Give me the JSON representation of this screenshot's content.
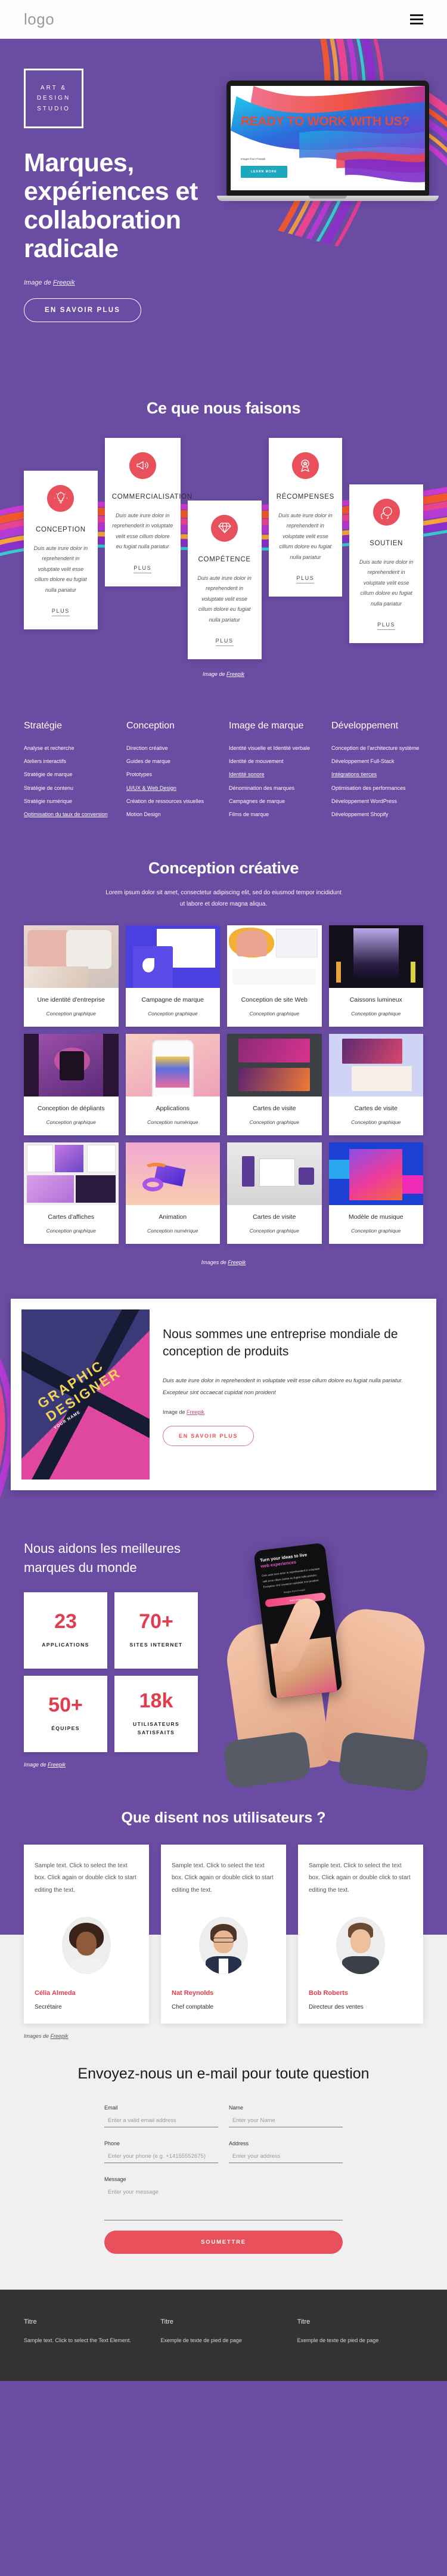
{
  "navbar": {
    "logo": "logo",
    "menu_icon": "hamburger-icon"
  },
  "hero": {
    "badge_lines": [
      "ART &",
      "DESIGN",
      "STUDIO"
    ],
    "title": "Marques, expériences et collaboration radicale",
    "credit_prefix": "Image de ",
    "credit_link": "Freepik",
    "cta": "EN SAVOIR PLUS",
    "laptop": {
      "headline": "READY TO WORK WITH US?",
      "credit": "Images from Freepik",
      "button": "LEARN MORE"
    }
  },
  "services": {
    "title": "Ce que nous faisons",
    "more_label": "PLUS",
    "credit_prefix": "Image de ",
    "credit_link": "Freepik",
    "body": "Duis aute irure dolor in reprehenderit in voluptate velit esse cillum dolore eu fugiat nulla pariatur",
    "items": [
      {
        "name": "CONCEPTION",
        "icon": "lightbulb-icon"
      },
      {
        "name": "COMMERCIALISATION",
        "icon": "megaphone-icon"
      },
      {
        "name": "COMPÉTENCE",
        "icon": "diamond-icon"
      },
      {
        "name": "RÉCOMPENSES",
        "icon": "award-ribbon-icon"
      },
      {
        "name": "SOUTIEN",
        "icon": "support-chat-icon"
      }
    ]
  },
  "linkcols": [
    {
      "heading": "Stratégie",
      "links": [
        {
          "t": "Analyse et recherche",
          "u": false
        },
        {
          "t": "Ateliers interactifs",
          "u": false
        },
        {
          "t": "Stratégie de marque",
          "u": false
        },
        {
          "t": "Stratégie de contenu",
          "u": false
        },
        {
          "t": "Stratégie numérique",
          "u": false
        },
        {
          "t": "Optimisation du taux de conversion",
          "u": true
        }
      ]
    },
    {
      "heading": "Conception",
      "links": [
        {
          "t": "Direction créative",
          "u": false
        },
        {
          "t": "Guides de marque",
          "u": false
        },
        {
          "t": "Prototypes",
          "u": false
        },
        {
          "t": "UI/UX & Web Design",
          "u": true
        },
        {
          "t": "Création de ressources visuelles",
          "u": false
        },
        {
          "t": "Motion Design",
          "u": false
        }
      ]
    },
    {
      "heading": "Image de marque",
      "links": [
        {
          "t": "Identité visuelle et Identité verbale",
          "u": false
        },
        {
          "t": "Identité de mouvement",
          "u": false
        },
        {
          "t": "Identité sonore",
          "u": true
        },
        {
          "t": "Dénomination des marques",
          "u": false
        },
        {
          "t": "Campagnes de marque",
          "u": false
        },
        {
          "t": "Films de marque",
          "u": false
        }
      ]
    },
    {
      "heading": "Développement",
      "links": [
        {
          "t": "Conception de l'architecture système",
          "u": false
        },
        {
          "t": "Développement Full-Stack",
          "u": false
        },
        {
          "t": "Intégrations tierces",
          "u": true
        },
        {
          "t": "Optimisation des performances",
          "u": false
        },
        {
          "t": "Développement WordPress",
          "u": false
        },
        {
          "t": "Développement Shopify",
          "u": false
        }
      ]
    }
  ],
  "portfolio": {
    "title": "Conception créative",
    "subtitle": "Lorem ipsum dolor sit amet, consectetur adipiscing elit, sed do eiusmod tempor incididunt ut labore et dolore magna aliqua.",
    "credit_prefix": "Images de ",
    "credit_link": "Freepik",
    "items": [
      {
        "title": "Une identité d'entreprise",
        "cat": "Conception graphique",
        "thumb": "branding-marble"
      },
      {
        "title": "Campagne de marque",
        "cat": "Conception graphique",
        "thumb": "book-cover-blue"
      },
      {
        "title": "Conception de site Web",
        "cat": "Conception graphique",
        "thumb": "seo-landing-page"
      },
      {
        "title": "Caissons lumineux",
        "cat": "Conception graphique",
        "thumb": "night-party-billboard"
      },
      {
        "title": "Conception de dépliants",
        "cat": "Conception graphique",
        "thumb": "ux-poster-purple"
      },
      {
        "title": "Applications",
        "cat": "Conception numérique",
        "thumb": "phone-mockup-pink"
      },
      {
        "title": "Cartes de visite",
        "cat": "Conception graphique",
        "thumb": "business-cards-magenta"
      },
      {
        "title": "Cartes de visite",
        "cat": "Conception graphique",
        "thumb": "business-cards-lilac"
      },
      {
        "title": "Cartes d'affiches",
        "cat": "Conception graphique",
        "thumb": "magazine-spread"
      },
      {
        "title": "Animation",
        "cat": "Conception numérique",
        "thumb": "concert-poster-pink"
      },
      {
        "title": "Cartes de visite",
        "cat": "Conception graphique",
        "thumb": "stationery-mockup"
      },
      {
        "title": "Modèle de musique",
        "cat": "Conception graphique",
        "thumb": "karaoke-gradient"
      }
    ]
  },
  "about": {
    "heading": "Nous sommes une entreprise mondiale de conception de produits",
    "paragraph": "Duis aute irure dolor in reprehenderit in voluptate velit esse cillum dolore eu fugiat nulla pariatur. Excepteur sint occaecat cupidat non proident",
    "credit_prefix": "Image de ",
    "credit_link": "Freepik",
    "cta": "EN SAVOIR PLUS",
    "image_text": [
      "GRAPHIC",
      "DESIGNER",
      "YOUR NAME"
    ]
  },
  "stats": {
    "heading": "Nous aidons les meilleures marques du monde",
    "credit_prefix": "Image de ",
    "credit_link": "Freepik",
    "items": [
      {
        "num": "23",
        "label": "APPLICATIONS"
      },
      {
        "num": "70+",
        "label": "SITES INTERNET"
      },
      {
        "num": "50+",
        "label": "ÉQUIPES"
      },
      {
        "num": "18k",
        "label": "UTILISATEURS SATISFAITS"
      }
    ],
    "phone": {
      "line1": "Turn your ideas to live",
      "line2": "web experiences",
      "body": "Duis aute irure dolor in reprehenderit in voluptate velit esse cillum dolore eu fugiat nulla pariatur. Excepteur sint occaecat cupidatat non proident",
      "credit": "Images from Freepik",
      "button": "learn more"
    }
  },
  "testimonials": {
    "title": "Que disent nos utilisateurs ?",
    "credit_prefix": "Images de ",
    "credit_link": "Freepik",
    "items": [
      {
        "text": "Sample text. Click to select the text box. Click again or double click to start editing the text.",
        "name": "Célia Almeda",
        "role": "Secrétaire",
        "avatar": "avatar-celia"
      },
      {
        "text": "Sample text. Click to select the text box. Click again or double click to start editing the text.",
        "name": "Nat Reynolds",
        "role": "Chef comptable",
        "avatar": "avatar-nat"
      },
      {
        "text": "Sample text. Click to select the text box. Click again or double click to start editing the text.",
        "name": "Bob Roberts",
        "role": "Directeur des ventes",
        "avatar": "avatar-bob"
      }
    ]
  },
  "contact": {
    "heading": "Envoyez-nous un e-mail pour toute question",
    "fields": {
      "email": {
        "label": "Email",
        "placeholder": "Enter a valid email address"
      },
      "name": {
        "label": "Name",
        "placeholder": "Enter your Name"
      },
      "phone": {
        "label": "Phone",
        "placeholder": "Enter your phone (e.g. +14155552675)"
      },
      "address": {
        "label": "Address",
        "placeholder": "Enter your address"
      },
      "message": {
        "label": "Message",
        "placeholder": "Enter your message"
      }
    },
    "submit": "SOUMETTRE"
  },
  "footer": {
    "columns": [
      {
        "heading": "Titre",
        "text": "Sample text. Click to select the Text Element."
      },
      {
        "heading": "Titre",
        "text": "Exemple de texte de pied de page"
      },
      {
        "heading": "Titre",
        "text": "Exemple de texte de pied de page"
      }
    ]
  },
  "colors": {
    "purple": "#6a4ca3",
    "red": "#e8505b",
    "red_dark": "#e23d4e",
    "dark": "#333333",
    "light": "#f0f0f0"
  }
}
